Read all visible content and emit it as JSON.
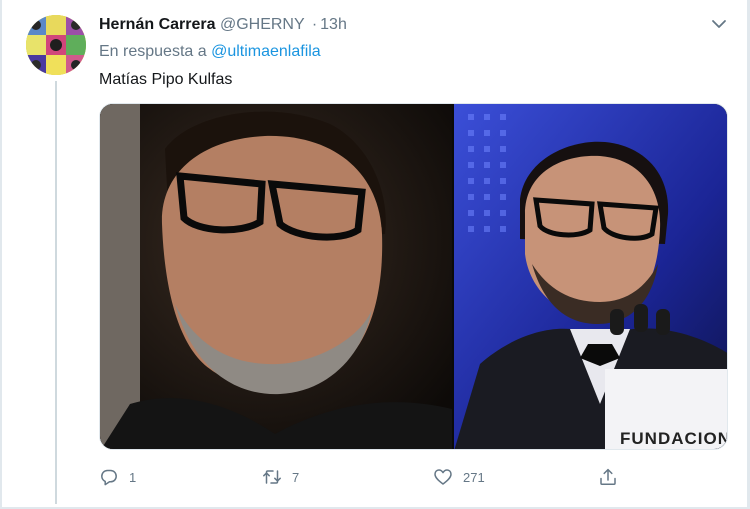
{
  "tweet": {
    "display_name": "Hernán Carrera",
    "handle": "@GHERNY",
    "separator": "·",
    "time": "13h",
    "reply_prefix": "En respuesta a",
    "reply_to": "@ultimaenlafila",
    "text": "Matías Pipo Kulfas",
    "media_text": "FUNDACION",
    "menu_icon": "chevron-down-icon"
  },
  "actions": {
    "reply_count": "1",
    "retweet_count": "7",
    "like_count": "271",
    "share_count": ""
  },
  "colors": {
    "name": "#14171a",
    "secondary": "#657786",
    "link": "#1b95e0",
    "border": "#e1e8ed"
  }
}
